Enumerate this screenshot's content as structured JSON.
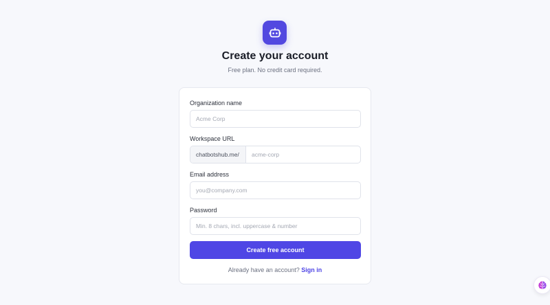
{
  "header": {
    "logo_icon": "robot-icon",
    "title": "Create your account",
    "subtitle": "Free plan. No credit card required."
  },
  "form": {
    "organization": {
      "label": "Organization name",
      "placeholder": "Acme Corp",
      "value": ""
    },
    "workspace": {
      "label": "Workspace URL",
      "prefix": "chatbotshub.me/",
      "placeholder": "acme-corp",
      "value": ""
    },
    "email": {
      "label": "Email address",
      "placeholder": "you@company.com",
      "value": ""
    },
    "password": {
      "label": "Password",
      "placeholder": "Min. 8 chars, incl. uppercase & number",
      "value": ""
    },
    "submit_label": "Create free account",
    "signin_prompt": "Already have an account?",
    "signin_link": "Sign in"
  },
  "widget": {
    "icon": "brain-icon"
  },
  "colors": {
    "accent": "#4f46e5",
    "background": "#f7f8fc",
    "card": "#ffffff"
  }
}
